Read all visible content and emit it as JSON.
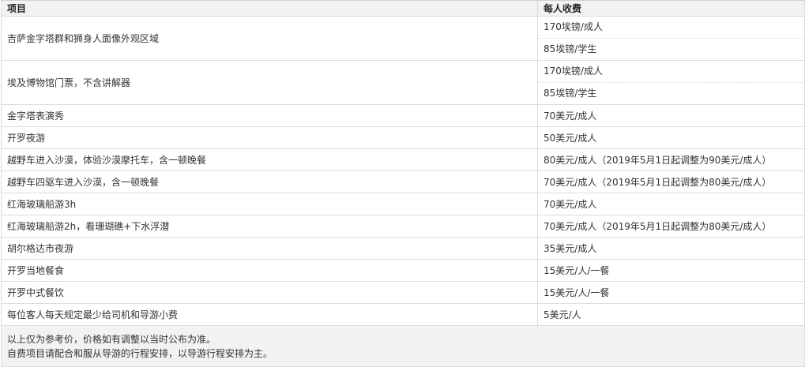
{
  "table": {
    "headers": {
      "item": "项目",
      "price": "每人收费"
    },
    "rows": [
      {
        "item": "吉萨金字塔群和狮身人面像外观区域",
        "prices": [
          "170埃镑/成人",
          "85埃镑/学生"
        ]
      },
      {
        "item": "埃及博物馆门票，不含讲解器",
        "prices": [
          "170埃镑/成人",
          "85埃镑/学生"
        ]
      },
      {
        "item": "金字塔表演秀",
        "prices": [
          "70美元/成人"
        ]
      },
      {
        "item": "开罗夜游",
        "prices": [
          "50美元/成人"
        ]
      },
      {
        "item": "越野车进入沙漠，体验沙漠摩托车，含一顿晚餐",
        "prices": [
          "80美元/成人（2019年5月1日起调整为90美元/成人）"
        ]
      },
      {
        "item": "越野车四驱车进入沙漠，含一顿晚餐",
        "prices": [
          "70美元/成人（2019年5月1日起调整为80美元/成人）"
        ]
      },
      {
        "item": "红海玻璃船游3h",
        "prices": [
          "70美元/成人"
        ]
      },
      {
        "item": "红海玻璃船游2h，看珊瑚礁+下水浮潜",
        "prices": [
          "70美元/成人（2019年5月1日起调整为80美元/成人）"
        ]
      },
      {
        "item": "胡尔格达市夜游",
        "prices": [
          "35美元/成人"
        ]
      },
      {
        "item": "开罗当地餐食",
        "prices": [
          "15美元/人/一餐"
        ]
      },
      {
        "item": "开罗中式餐饮",
        "prices": [
          "15美元/人/一餐"
        ]
      },
      {
        "item": "每位客人每天规定最少给司机和导游小费",
        "prices": [
          "5美元/人"
        ]
      }
    ],
    "notes": [
      "以上仅为参考价，价格如有调整以当时公布为准。",
      "自费项目请配合和服从导游的行程安排，以导游行程安排为主。"
    ]
  }
}
